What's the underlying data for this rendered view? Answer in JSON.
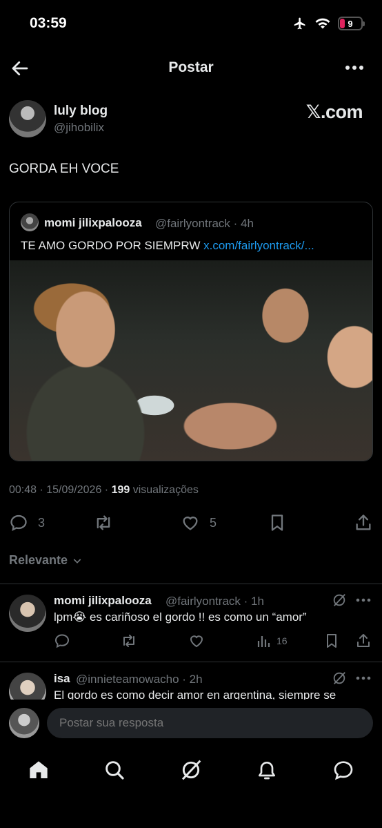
{
  "status_bar": {
    "time": "03:59",
    "battery": "9"
  },
  "header": {
    "title": "Postar"
  },
  "post": {
    "author_name": "luly blog",
    "author_handle": "@jihobilix",
    "source_logo": "𝕏.com",
    "text": "GORDA EH VOCE",
    "quote": {
      "name": "momi jilixpalooza",
      "handle_time": "@fairlyontrack · 4h",
      "text": "TE AMO GORDO POR SIEMPRW ",
      "link": "x.com/fairlyontrack/..."
    },
    "meta_time": "00:48 · 15/09/2026 · ",
    "meta_views": "199",
    "meta_views_label": " visualizações",
    "replies_count": "3",
    "likes_count": "5"
  },
  "sort": {
    "label": "Relevante"
  },
  "replies": [
    {
      "name": "momi jilixpalooza",
      "handle_time": "@fairlyontrack · 1h",
      "text": "lpm😭  es cariñoso el gordo !! es como un “amor”",
      "views": "16"
    },
    {
      "name": "isa",
      "handle_time": "@innieteamowacho · 2h",
      "text": "El gordo es como decir amor en argentina, siempre se"
    }
  ],
  "composer": {
    "placeholder": "Postar sua resposta"
  },
  "colors": {
    "accent": "#1d9bf0",
    "muted": "#71767b",
    "text": "#e7e9ea",
    "background": "#000000"
  },
  "icons": [
    "back-arrow-icon",
    "more-icon",
    "reply-icon",
    "retweet-icon",
    "like-icon",
    "bookmark-icon",
    "share-icon",
    "grok-icon",
    "views-icon",
    "home-icon",
    "search-icon",
    "notifications-icon",
    "messages-icon"
  ]
}
